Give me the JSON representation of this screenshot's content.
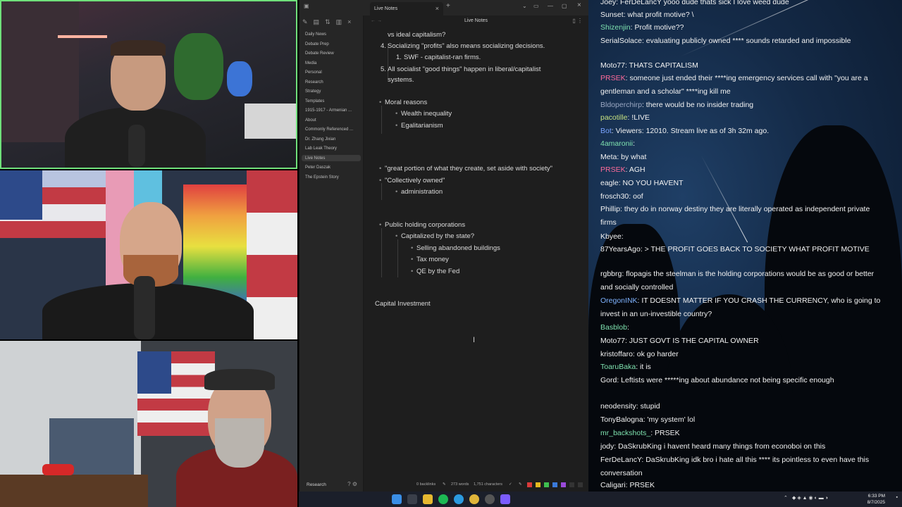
{
  "app": {
    "tab_title": "Live Notes",
    "editor_title": "Live Notes",
    "close": "×",
    "new_tab": "+",
    "win_min": "—",
    "win_max": "▢",
    "win_close": "×"
  },
  "sidebar": {
    "items": [
      "Daily News",
      "Debate Prep",
      "Debate Review",
      "Media",
      "Personal",
      "Research",
      "Strategy",
      "Templates",
      "1915-1917 - Armenian ...",
      "About",
      "Commonly Referenced ...",
      "Dr. Zhang Jixian",
      "Lab Leak Theory",
      "Live Notes",
      "Peter Daszak",
      "The Epstein Story"
    ],
    "vault": "Research"
  },
  "notes": {
    "l1": "vs ideal capitalism?",
    "l2_num": "4.",
    "l2": "Socializing \"profits\" also means socializing decisions.",
    "l3_num": "1.",
    "l3": "SWF - capitalist-ran firms.",
    "l4_num": "5.",
    "l4a": "All socialist \"good things\" happen in liberal/capitalist",
    "l4b": "systems.",
    "l5": "Moral reasons",
    "l6": "Wealth inequality",
    "l7": "Egalitarianism",
    "l8": "\"great portion of what they create, set aside with society\"",
    "l9": "\"Collectively owned\"",
    "l10": "administration",
    "l11": "Public holding corporations",
    "l12": "Capitalized by the state?",
    "l13": "Selling abandoned buildings",
    "l14": "Tax money",
    "l15": "QE by the Fed",
    "l16": "Capital Investment"
  },
  "status": {
    "backlinks": "0 backlinks",
    "words": "273 words",
    "chars": "1,751 characters"
  },
  "chat": {
    "messages": [
      {
        "user": "Joey: FerDeLancY yooo",
        "text": " dude thats sick  I love weed dude",
        "color": "#f2f2f2"
      },
      {
        "user": "Sunset",
        "text": ": what profit motive? \\",
        "color": "#f2f2f2"
      },
      {
        "user": "Shizenjin",
        "text": ": Profit motive??",
        "color": "#7fe3b0"
      },
      {
        "user": "SerialSolace",
        "text": ": evaluating publicly owned **** sounds retarded and impossible",
        "color": "#f2f2f2"
      },
      {
        "user": "Moto77",
        "text": ": THATS CAPITALISM",
        "color": "#f2f2f2"
      },
      {
        "user": "PRSEK",
        "text": ": someone just ended their ****ing emergency services call with \"you are a gentleman and a scholar\" ****ing kill me",
        "color": "#ff6b9a"
      },
      {
        "user": "Bldoperchirp",
        "text": ": there would be no insider trading",
        "color": "#9aa7c2"
      },
      {
        "user": "pacotille",
        "text": ": !LIVE",
        "color": "#c6e07f"
      },
      {
        "user": "Bot",
        "text": ": Viewers: 12010. Stream live as of 3h 32m ago.",
        "color": "#7aa4ff"
      },
      {
        "user": "4amaronii",
        "text": ":",
        "color": "#7fe3b0"
      },
      {
        "user": "Meta",
        "text": ": by what",
        "color": "#f2f2f2"
      },
      {
        "user": "PRSEK",
        "text": ": AGH",
        "color": "#ff6b9a"
      },
      {
        "user": "eagle",
        "text": ": NO YOU HAVENT",
        "color": "#f2f2f2"
      },
      {
        "user": "frosch30",
        "text": ": oof",
        "color": "#f2f2f2"
      },
      {
        "user": "Phillip",
        "text": ": they do in norway destiny they are literally operated as independent private firms",
        "color": "#f2f2f2"
      },
      {
        "user": "Kbyee",
        "text": ":",
        "color": "#f2f2f2"
      },
      {
        "user": "87YearsAgo",
        "text": ": > THE PROFIT GOES BACK TO SOCIETY  WHAT PROFIT MOTIVE",
        "color": "#f2f2f2"
      },
      {
        "user": "rgbbrg",
        "text": ": flopagis the steelman is the holding corporations would be as good or better and socially controlled",
        "color": "#f2f2f2"
      },
      {
        "user": "OregonINK",
        "text": ": IT DOESNT MATTER IF YOU CRASH THE CURRENCY, who is going to invest in an un-investible country?",
        "color": "#7fb3ff"
      },
      {
        "user": "Basblob",
        "text": ":",
        "color": "#7fe3b0"
      },
      {
        "user": "Moto77",
        "text": ": JUST GOVT IS THE CAPITAL OWNER",
        "color": "#f2f2f2"
      },
      {
        "user": "kristoffaro",
        "text": ": ok go harder",
        "color": "#f2f2f2"
      },
      {
        "user": "ToaruBaka",
        "text": ": it is",
        "color": "#7fe3b0"
      },
      {
        "user": "Gord",
        "text": ": Leftists were *****ing about abundance not being specific enough",
        "color": "#f2f2f2"
      },
      {
        "user": "neodensity",
        "text": ": stupid",
        "color": "#f2f2f2"
      },
      {
        "user": "TonyBalogna",
        "text": ": 'my system' lol",
        "color": "#f2f2f2"
      },
      {
        "user": "mr_backshots_",
        "text": ": PRSEK",
        "color": "#7fe3b0"
      },
      {
        "user": "jody",
        "text": ": DaSkrubKing  i havent heard many things from econoboi on this",
        "color": "#f2f2f2"
      },
      {
        "user": "FerDeLancY",
        "text": ": DaSkrubKing idk bro i hate all this **** its pointless to even have this conversation",
        "color": "#f2f2f2"
      },
      {
        "user": "Caligari",
        "text": ": PRSEK",
        "color": "#f2f2f2"
      }
    ]
  },
  "clock": {
    "time": "6:33 PM",
    "date": "8/7/2025"
  },
  "colors": {
    "accent": "#7b5cff",
    "cam_border": "#6fe07a"
  }
}
